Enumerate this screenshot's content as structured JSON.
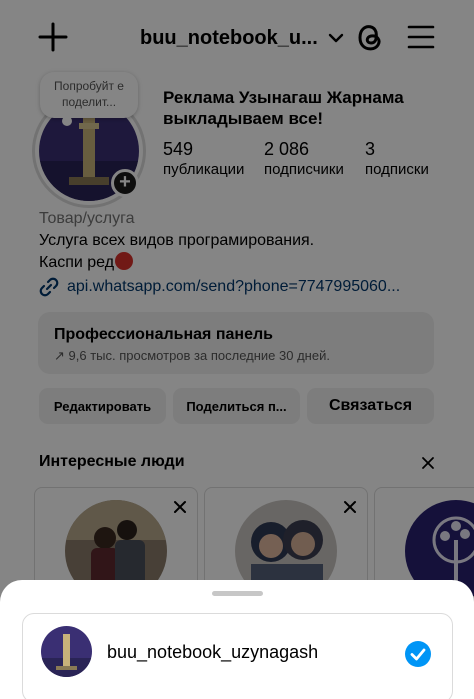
{
  "header": {
    "account_name": "buu_notebook_u...",
    "new_post_icon": "plus-icon",
    "threads_icon": "threads-icon",
    "menu_icon": "menu-icon"
  },
  "profile": {
    "note_bubble": "Попробуйт е поделит...",
    "name_line1": "Реклама Узынагаш Жарнама",
    "name_line2": "выкладываем все!",
    "stats": [
      {
        "number": "549",
        "label": "публикации"
      },
      {
        "number": "2 086",
        "label": "подписчики"
      },
      {
        "number": "3",
        "label": "подписки"
      }
    ],
    "category": "Товар/услуга",
    "bio_line1": "Услуга всех видов програмирования.",
    "bio_line2": "Каспи ред",
    "link": "api.whatsapp.com/send?phone=7747995060..."
  },
  "pro_panel": {
    "title": "Профессиональная панель",
    "subtitle": "9,6 тыс. просмотров за последние 30 дней."
  },
  "buttons": {
    "edit": "Редактировать",
    "share": "Поделиться п...",
    "contact": "Связаться"
  },
  "suggested": {
    "title": "Интересные люди"
  },
  "sheet": {
    "account": "buu_notebook_uzynagash"
  },
  "colors": {
    "link": "#00376b",
    "check": "#0095f6",
    "button_bg": "#efefef"
  }
}
